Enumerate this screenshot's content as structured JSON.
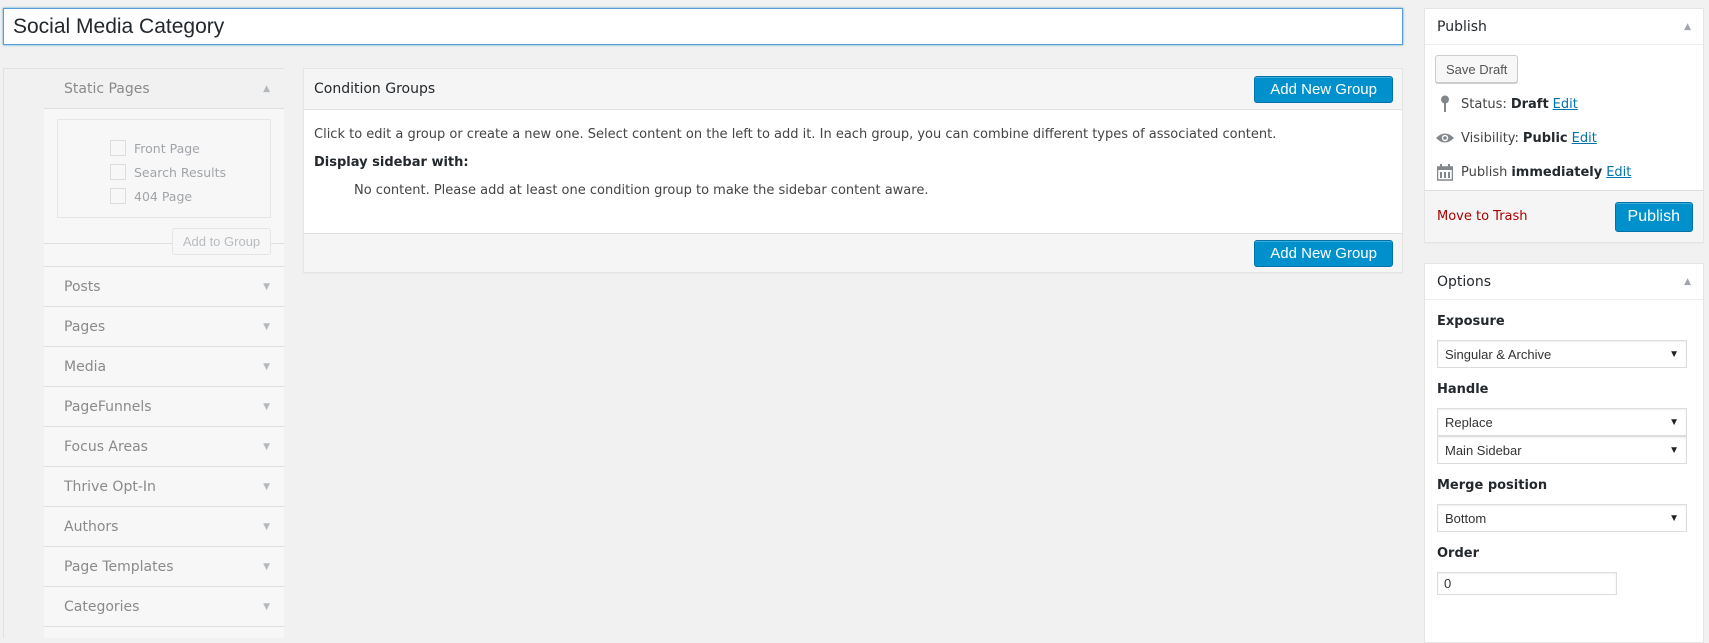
{
  "title_input": {
    "value": "Social Media Category"
  },
  "left_panel": {
    "open_section": {
      "label": "Static Pages",
      "options": [
        {
          "label": "Front Page",
          "checked": false
        },
        {
          "label": "Search Results",
          "checked": false
        },
        {
          "label": "404 Page",
          "checked": false
        }
      ],
      "add_button": "Add to Group"
    },
    "sections": [
      {
        "label": "Posts"
      },
      {
        "label": "Pages"
      },
      {
        "label": "Media"
      },
      {
        "label": "PageFunnels"
      },
      {
        "label": "Focus Areas"
      },
      {
        "label": "Thrive Opt-In"
      },
      {
        "label": "Authors"
      },
      {
        "label": "Page Templates"
      },
      {
        "label": "Categories"
      }
    ]
  },
  "condition_groups": {
    "title": "Condition Groups",
    "add_button_top": "Add New Group",
    "add_button_bottom": "Add New Group",
    "instructions": "Click to edit a group or create a new one. Select content on the left to add it. In each group, you can combine different types of associated content.",
    "display_label": "Display sidebar with:",
    "empty_message": "No content. Please add at least one condition group to make the sidebar content aware."
  },
  "publish_box": {
    "title": "Publish",
    "save_draft": "Save Draft",
    "status_label": "Status:",
    "status_value": "Draft",
    "visibility_label": "Visibility:",
    "visibility_value": "Public",
    "publish_label": "Publish",
    "publish_value": "immediately",
    "edit_link": "Edit",
    "trash_link": "Move to Trash",
    "publish_button": "Publish"
  },
  "options_box": {
    "title": "Options",
    "exposure_label": "Exposure",
    "exposure_value": "Singular & Archive",
    "handle_label": "Handle",
    "handle_value": "Replace",
    "sidebar_value": "Main Sidebar",
    "merge_label": "Merge position",
    "merge_value": "Bottom",
    "order_label": "Order",
    "order_value": "0"
  },
  "colors": {
    "primary_button": "#0091cd",
    "link": "#0073aa",
    "trash": "#a00000",
    "background": "#f1f1f1"
  }
}
